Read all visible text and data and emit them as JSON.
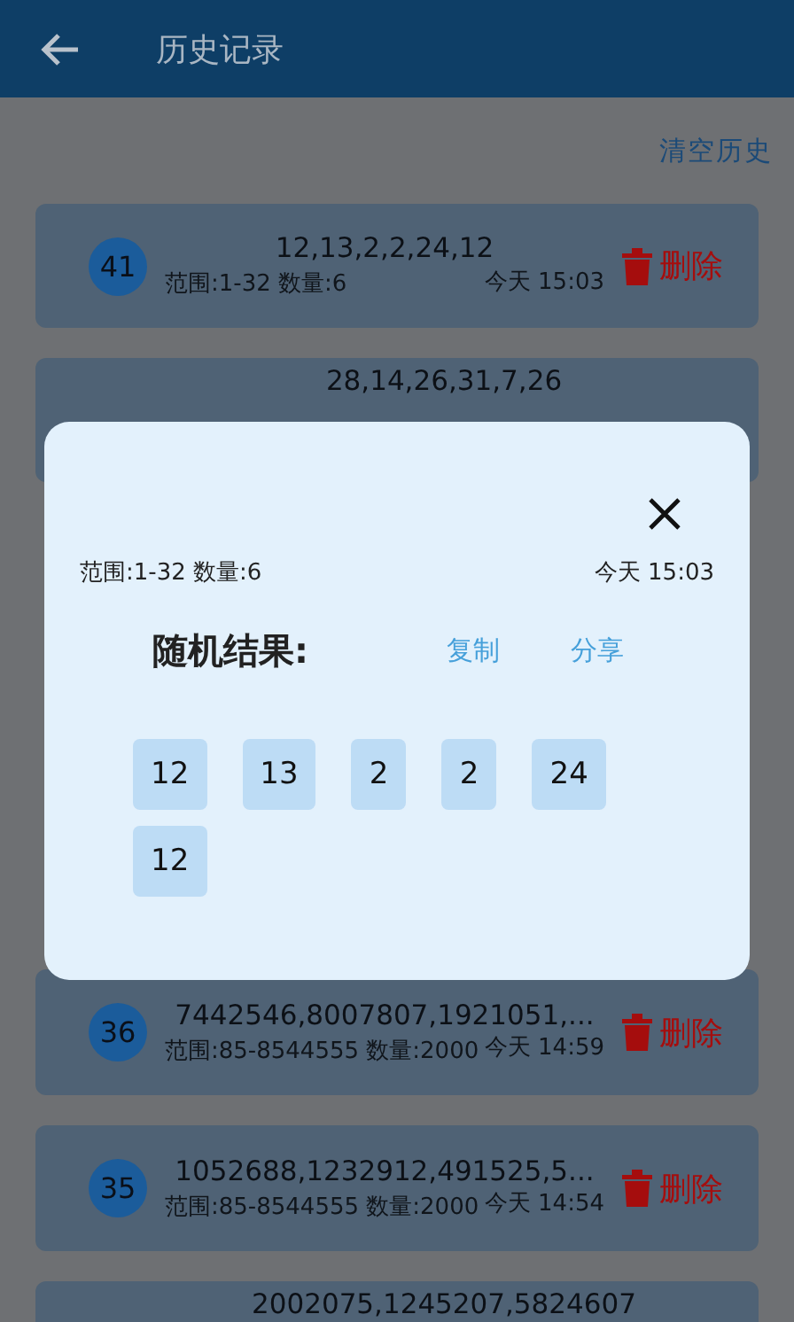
{
  "app_bar": {
    "title": "历史记录"
  },
  "clear_history": "清空历史",
  "records": [
    {
      "index": "41",
      "numbers": "12,13,2,2,24,12",
      "range": "范围:1-32 数量:6",
      "time": "今天 15:03",
      "delete": "删除"
    },
    {
      "numbers": "28,14,26,31,7,26"
    },
    {
      "index": "36",
      "numbers": "7442546,8007807,1921051,...",
      "range": "范围:85-8544555 数量:2000",
      "time": "今天 14:59",
      "delete": "删除"
    },
    {
      "index": "35",
      "numbers": "1052688,1232912,491525,5...",
      "range": "范围:85-8544555 数量:2000",
      "time": "今天 14:54",
      "delete": "删除"
    },
    {
      "numbers": "2002075,1245207,5824607"
    }
  ],
  "dialog": {
    "range": "范围:1-32 数量:6",
    "time": "今天 15:03",
    "title": "随机结果:",
    "copy": "复制",
    "share": "分享",
    "results": [
      "12",
      "13",
      "2",
      "2",
      "24",
      "12"
    ]
  }
}
